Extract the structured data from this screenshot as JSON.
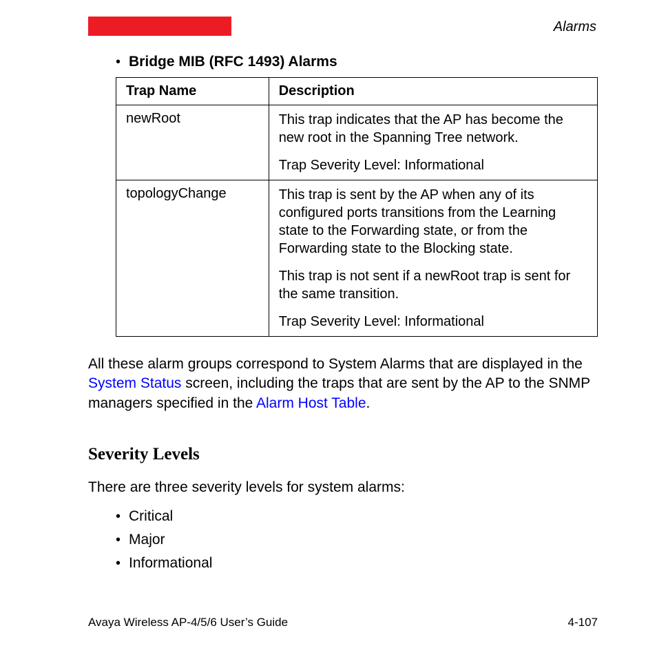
{
  "header": {
    "section": "Alarms"
  },
  "bullet_heading": "Bridge MIB (RFC 1493) Alarms",
  "table": {
    "headers": {
      "name": "Trap Name",
      "desc": "Description"
    },
    "rows": [
      {
        "name": "newRoot",
        "paras": [
          "This trap indicates that the AP has become the new root in the Spanning Tree network.",
          "Trap Severity Level: Informational"
        ]
      },
      {
        "name": "topologyChange",
        "paras": [
          "This trap is sent by the AP when any of its configured ports transitions from the Learning state to the Forwarding state, or from the Forwarding state to the Blocking state.",
          "This trap is not sent if a newRoot trap is sent for the same transition.",
          "Trap Severity Level: Informational"
        ]
      }
    ]
  },
  "summary": {
    "pre": "All these alarm groups correspond to System Alarms that are displayed in the ",
    "link1": "System Status",
    "mid": " screen, including the traps that are sent by the AP to the SNMP managers specified in the ",
    "link2": "Alarm Host Table",
    "post": "."
  },
  "severity": {
    "heading": "Severity Levels",
    "intro": "There are three severity levels for system alarms:",
    "items": [
      "Critical",
      "Major",
      "Informational"
    ]
  },
  "footer": {
    "left": "Avaya Wireless AP-4/5/6 User’s Guide",
    "right": "4-107"
  }
}
